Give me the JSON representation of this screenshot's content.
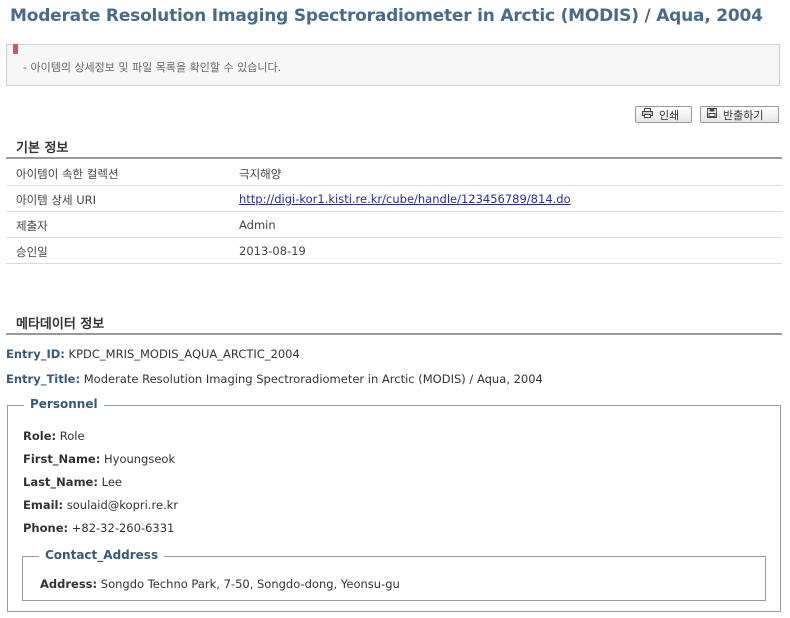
{
  "page_title": "Moderate Resolution Imaging Spectroradiometer in Arctic (MODIS) / Aqua, 2004",
  "notice_text": "- 아이템의 상세정보 및 파일 목록을 확인할 수 있습니다.",
  "buttons": {
    "print": "인쇄",
    "export": "반출하기"
  },
  "basic_info": {
    "title": "기본 정보",
    "rows": [
      {
        "key": "아이템이 속한 컬렉션",
        "value": "극지해양"
      },
      {
        "key": "아이템 상세 URI",
        "value": "http://digi-kor1.kisti.re.kr/cube/handle/123456789/814.do"
      },
      {
        "key": "제출자",
        "value": "Admin"
      },
      {
        "key": "승인일",
        "value": "2013-08-19"
      }
    ]
  },
  "metadata": {
    "title": "메타데이터 정보",
    "entry_id_label": "Entry_ID:",
    "entry_id": "KPDC_MRIS_MODIS_AQUA_ARCTIC_2004",
    "entry_title_label": "Entry_Title:",
    "entry_title": "Moderate Resolution Imaging Spectroradiometer in Arctic (MODIS) / Aqua, 2004",
    "personnel": {
      "legend": "Personnel",
      "role_label": "Role:",
      "role": "Role",
      "first_name_label": "First_Name:",
      "first_name": "Hyoungseok",
      "last_name_label": "Last_Name:",
      "last_name": "Lee",
      "email_label": "Email:",
      "email": "soulaid@kopri.re.kr",
      "phone_label": "Phone:",
      "phone": "+82-32-260-6331",
      "contact": {
        "legend": "Contact_Address",
        "address_label": "Address:",
        "address": "Songdo Techno Park, 7-50, Songdo-dong, Yeonsu-gu"
      }
    }
  },
  "icons": {
    "print": "printer-icon",
    "export": "disk-icon"
  }
}
